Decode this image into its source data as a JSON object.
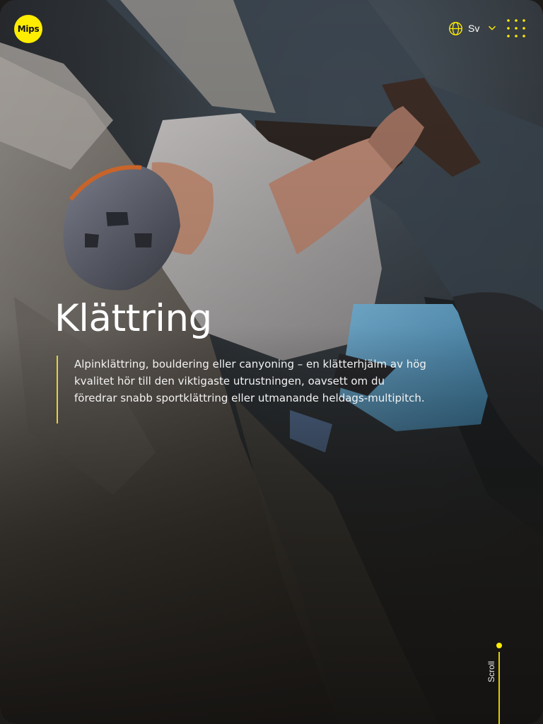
{
  "header": {
    "logo_text": "Mips",
    "language": {
      "code": "Sv",
      "icon": "globe-icon",
      "dropdown_icon": "chevron-down-icon"
    },
    "menu_icon": "dots-grid-icon"
  },
  "hero": {
    "title": "Klättring",
    "description": "Alpinklättring, bouldering eller canyoning – en klätterhjälm av hög kvalitet hör till den viktigaste utrustningen, oavsett om du föredrar snabb sportklättring eller utmanande heldags-multipitch.",
    "image": "climber-with-helmet-photo"
  },
  "scroll": {
    "label": "Scroll"
  },
  "colors": {
    "accent": "#ffed00",
    "description_rule": "#e3d23c",
    "text": "#ffffff"
  }
}
